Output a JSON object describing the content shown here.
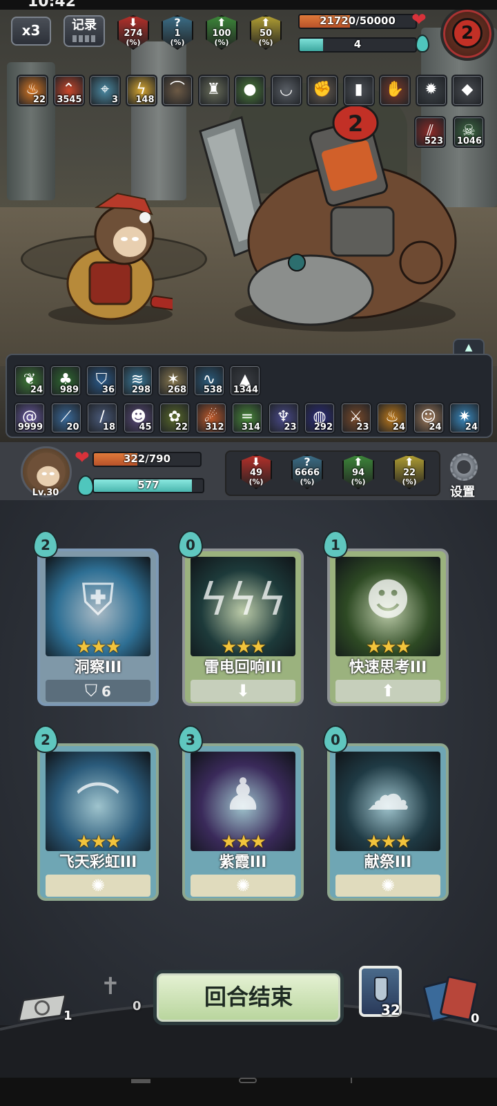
{
  "status_bar": {
    "time": "10:42"
  },
  "top": {
    "speed_label": "x3",
    "record_label": "记录",
    "enemy_buffs": [
      {
        "icon": "arrow-down-icon",
        "value": "274",
        "unit": "(%)",
        "color": "#b8302a"
      },
      {
        "icon": "question-icon",
        "value": "1",
        "unit": "(%)",
        "color": "#3b6f89"
      },
      {
        "icon": "arrow-up-icon",
        "value": "100",
        "unit": "(%)",
        "color": "#3d8a3a"
      },
      {
        "icon": "arrow-up-icon",
        "value": "50",
        "unit": "(%)",
        "color": "#b5a233"
      }
    ],
    "enemy_hp": "21720/50000",
    "enemy_hp_fraction": 0.434,
    "enemy_mana": "4",
    "enemy_mana_fraction": 0.2,
    "enemy_portrait_number": "2"
  },
  "enemy_skills": [
    {
      "icon": "flame-icon",
      "count": "22",
      "color": "#d97824"
    },
    {
      "icon": "chevron-up-icon",
      "count": "3545",
      "color": "#c8462a"
    },
    {
      "icon": "crosshair-icon",
      "count": "3",
      "color": "#4b8aa3"
    },
    {
      "icon": "lightning-icon",
      "count": "148",
      "color": "#d9a832"
    },
    {
      "icon": "horn-icon",
      "count": "",
      "color": "#6d5a45"
    },
    {
      "icon": "totem-icon",
      "count": "",
      "color": "#6a6e5b"
    },
    {
      "icon": "seed-icon",
      "count": "",
      "color": "#4a7a3a"
    },
    {
      "icon": "bowl-icon",
      "count": "",
      "color": "#5a5f66"
    },
    {
      "icon": "fist-icon",
      "count": "",
      "color": "#6a5e52"
    },
    {
      "icon": "bracer-icon",
      "count": "",
      "color": "#4e5258"
    },
    {
      "icon": "gauntlet-icon",
      "count": "",
      "color": "#7a3a2a"
    },
    {
      "icon": "spiked-armor-icon",
      "count": "",
      "color": "#3e4348"
    },
    {
      "icon": "boulder-icon",
      "count": "",
      "color": "#4a4d52"
    }
  ],
  "enemy_status": [
    {
      "icon": "claw-icon",
      "count": "523",
      "color": "#8e2a26"
    },
    {
      "icon": "skull-icon",
      "count": "1046",
      "color": "#3d6a42"
    }
  ],
  "player_skills_row1": [
    {
      "icon": "leaf-icon",
      "count": "24",
      "color": "#3e7a36"
    },
    {
      "icon": "sprout-icon",
      "count": "989",
      "color": "#2f6a30"
    },
    {
      "icon": "shield-icon",
      "count": "36",
      "color": "#2a5a8a"
    },
    {
      "icon": "wind-icon",
      "count": "298",
      "color": "#3a7a9a"
    },
    {
      "icon": "burst-icon",
      "count": "268",
      "color": "#8a7a50"
    },
    {
      "icon": "wave-icon",
      "count": "538",
      "color": "#2a5a7a"
    },
    {
      "icon": "spikes-icon",
      "count": "1344",
      "color": "#3a3d42"
    }
  ],
  "player_skills_row2": [
    {
      "icon": "spiral-icon",
      "count": "9999",
      "color": "#6a5aa0"
    },
    {
      "icon": "slash-icon",
      "count": "20",
      "color": "#3a6a9a"
    },
    {
      "icon": "staff-icon",
      "count": "18",
      "color": "#4a5a7a"
    },
    {
      "icon": "demon-icon",
      "count": "45",
      "color": "#5a4a7a"
    },
    {
      "icon": "bush-icon",
      "count": "22",
      "color": "#5a6a2a"
    },
    {
      "icon": "comet-icon",
      "count": "312",
      "color": "#c05a2a"
    },
    {
      "icon": "beam-icon",
      "count": "314",
      "color": "#4a8a3a"
    },
    {
      "icon": "ghost-icon",
      "count": "23",
      "color": "#4a4a8a"
    },
    {
      "icon": "void-icon",
      "count": "292",
      "color": "#2a2a7a"
    },
    {
      "icon": "blade-icon",
      "count": "23",
      "color": "#7a4a2a"
    },
    {
      "icon": "fire-icon",
      "count": "24",
      "color": "#c07a1a"
    },
    {
      "icon": "monkey-face-icon",
      "count": "24",
      "color": "#a07a5a"
    },
    {
      "icon": "star-burst-icon",
      "count": "24",
      "color": "#3a8ac0"
    }
  ],
  "player": {
    "level": "Lv.30",
    "hp": "322/790",
    "hp_fraction": 0.408,
    "mana": "577",
    "mana_fraction": 0.9,
    "buffs": [
      {
        "icon": "arrow-down-icon",
        "value": "49",
        "unit": "(%)",
        "color": "#b8302a"
      },
      {
        "icon": "question-icon",
        "value": "6666",
        "unit": "(%)",
        "color": "#3b6f89"
      },
      {
        "icon": "arrow-up-icon",
        "value": "94",
        "unit": "(%)",
        "color": "#3d8a3a"
      },
      {
        "icon": "arrow-up-icon",
        "value": "22",
        "unit": "(%)",
        "color": "#b5a233"
      }
    ],
    "settings_label": "设置"
  },
  "cards": [
    {
      "cost": "2",
      "name": "洞察III",
      "stars": "★★★",
      "footer": "6",
      "footer_icon": "shield-icon",
      "frame": "#7d99b5",
      "band": "#7f98a8",
      "art": "#2e6f94",
      "foot_bg": "#5b6e7c",
      "art_icon": "guardian-icon"
    },
    {
      "cost": "0",
      "name": "雷电回响III",
      "stars": "★★★",
      "footer": "",
      "footer_icon": "arrow-down-icon",
      "frame": "#8f9396",
      "band": "#9bb27e",
      "art": "#1d3a3a",
      "foot_bg": "#c6cfbb",
      "art_icon": "lightning-icon"
    },
    {
      "cost": "1",
      "name": "快速思考III",
      "stars": "★★★",
      "footer": "",
      "footer_icon": "arrow-up-icon",
      "frame": "#8f9396",
      "band": "#9bb27e",
      "art": "#2e4a24",
      "foot_bg": "#c6cfbb",
      "art_icon": "thinker-icon"
    },
    {
      "cost": "2",
      "name": "飞天彩虹III",
      "stars": "★★★",
      "footer": "",
      "footer_icon": "whistle-icon",
      "frame": "#8fa88f",
      "band": "#6fa6b4",
      "art": "#2a5a7a",
      "foot_bg": "#e0dbbd",
      "art_icon": "rainbow-wings-icon"
    },
    {
      "cost": "3",
      "name": "紫霞III",
      "stars": "★★★",
      "footer": "",
      "footer_icon": "whistle-icon",
      "frame": "#8fa88f",
      "band": "#6fa6b4",
      "art": "#3a2a5a",
      "foot_bg": "#e0dbbd",
      "art_icon": "silhouette-icon"
    },
    {
      "cost": "0",
      "name": "献祭III",
      "stars": "★★★",
      "footer": "",
      "footer_icon": "whistle-icon",
      "frame": "#8fa88f",
      "band": "#6fa6b4",
      "art": "#1f3a44",
      "foot_bg": "#e0dbbd",
      "art_icon": "spirit-icon"
    }
  ],
  "bottom": {
    "draw_pile_count": "1",
    "grave_count": "0",
    "end_turn_label": "回合结束",
    "potion_count": "32",
    "discard_count": "0"
  }
}
